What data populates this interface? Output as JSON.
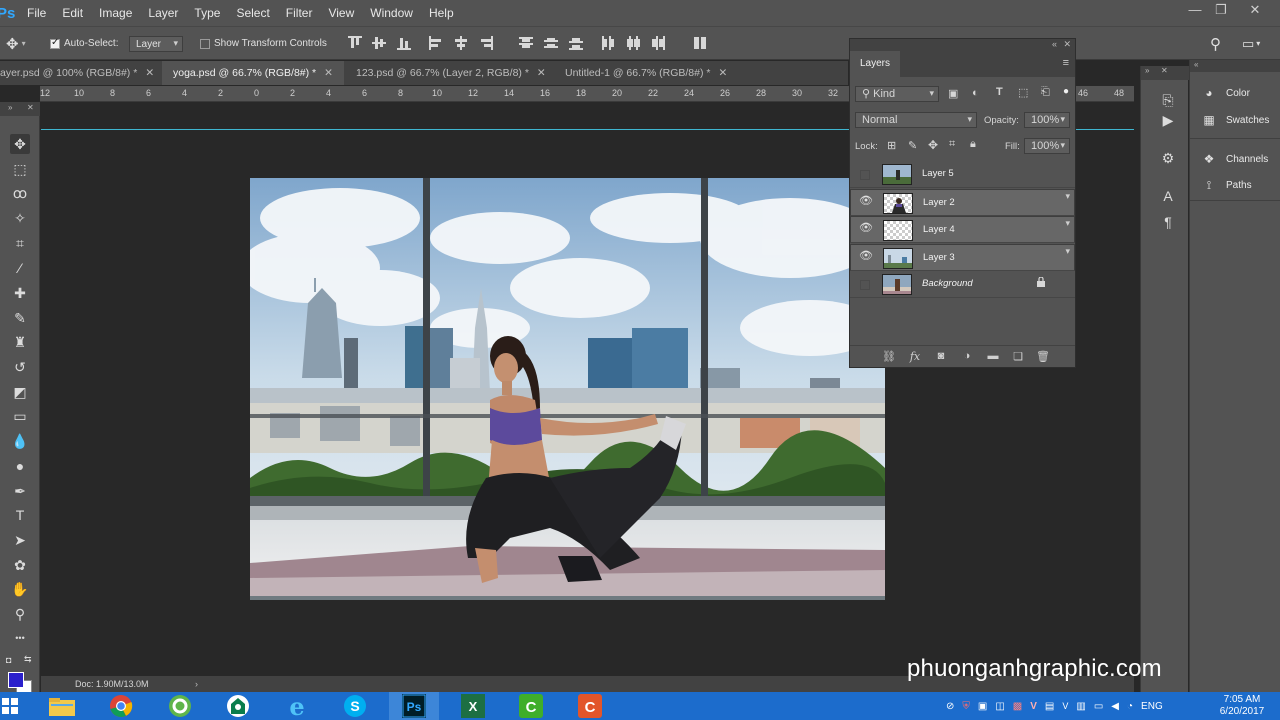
{
  "app": {
    "logo": "Ps"
  },
  "menu": [
    "File",
    "Edit",
    "Image",
    "Layer",
    "Type",
    "Select",
    "Filter",
    "View",
    "Window",
    "Help"
  ],
  "window_controls": {
    "minimize": "—",
    "restore": "❐",
    "close": "✕"
  },
  "options_bar": {
    "auto_select_label": "Auto-Select:",
    "auto_select_checked": true,
    "auto_select_target": "Layer",
    "transform_controls_label": "Show Transform Controls",
    "transform_controls_checked": false
  },
  "tabs": [
    {
      "label": "ayer.psd @ 100% (RGB/8#) *",
      "active": false
    },
    {
      "label": "yoga.psd @ 66.7% (RGB/8#) *",
      "active": true
    },
    {
      "label": "123.psd @ 66.7% (Layer 2, RGB/8) *",
      "active": false
    },
    {
      "label": "Untitled-1 @ 66.7% (RGB/8#) *",
      "active": false
    }
  ],
  "ruler_labels": [
    "12",
    "10",
    "8",
    "6",
    "4",
    "2",
    "0",
    "2",
    "4",
    "6",
    "8",
    "10",
    "12",
    "14",
    "16",
    "18",
    "20",
    "22",
    "24",
    "26",
    "28",
    "30",
    "32",
    "46",
    "48"
  ],
  "toolbar_tools": [
    {
      "name": "move-tool-icon",
      "glyph": "✥"
    },
    {
      "name": "marquee-tool-icon",
      "glyph": "⬚"
    },
    {
      "name": "lasso-tool-icon",
      "glyph": "ꝏ"
    },
    {
      "name": "magic-wand-tool-icon",
      "glyph": "✧"
    },
    {
      "name": "crop-tool-icon",
      "glyph": "⌗"
    },
    {
      "name": "eyedropper-tool-icon",
      "glyph": "⁄"
    },
    {
      "name": "healing-brush-tool-icon",
      "glyph": "✚"
    },
    {
      "name": "brush-tool-icon",
      "glyph": "✎"
    },
    {
      "name": "clone-stamp-tool-icon",
      "glyph": "♜"
    },
    {
      "name": "history-brush-tool-icon",
      "glyph": "↺"
    },
    {
      "name": "eraser-tool-icon",
      "glyph": "◩"
    },
    {
      "name": "gradient-tool-icon",
      "glyph": "▭"
    },
    {
      "name": "blur-tool-icon",
      "glyph": "💧"
    },
    {
      "name": "dodge-tool-icon",
      "glyph": "●"
    },
    {
      "name": "pen-tool-icon",
      "glyph": "✒"
    },
    {
      "name": "type-tool-icon",
      "glyph": "T"
    },
    {
      "name": "path-selection-tool-icon",
      "glyph": "➤"
    },
    {
      "name": "custom-shape-tool-icon",
      "glyph": "✿"
    },
    {
      "name": "hand-tool-icon",
      "glyph": "✋"
    },
    {
      "name": "zoom-tool-icon",
      "glyph": "⚲"
    },
    {
      "name": "more-tools-icon",
      "glyph": "•••"
    }
  ],
  "colors": {
    "foreground": "#2b20cc",
    "background": "#ffffff",
    "guide": "#3fb6d0"
  },
  "status": {
    "doc_size": "Doc: 1.90M/13.0M"
  },
  "layers_panel": {
    "title": "Layers",
    "filter_label": "Kind",
    "blend_mode": "Normal",
    "opacity_label": "Opacity:",
    "opacity_value": "100%",
    "lock_label": "Lock:",
    "fill_label": "Fill:",
    "fill_value": "100%",
    "layers": [
      {
        "name": "Layer 5",
        "visible": false,
        "selected": false,
        "thumb": "photo",
        "locked": false
      },
      {
        "name": "Layer 2",
        "visible": true,
        "selected": true,
        "thumb": "checker-person",
        "locked": false
      },
      {
        "name": "Layer 4",
        "visible": true,
        "selected": true,
        "thumb": "checker",
        "locked": false
      },
      {
        "name": "Layer 3",
        "visible": true,
        "selected": true,
        "thumb": "city",
        "locked": false
      },
      {
        "name": "Background",
        "visible": false,
        "selected": false,
        "thumb": "room",
        "locked": true
      }
    ]
  },
  "dock_panels": [
    {
      "label": "Color",
      "icon": "palette-icon"
    },
    {
      "label": "Swatches",
      "icon": "swatches-icon"
    },
    {
      "label": "Channels",
      "icon": "channels-icon"
    },
    {
      "label": "Paths",
      "icon": "paths-icon"
    }
  ],
  "watermark": "phuonganhgraphic.com",
  "taskbar": {
    "apps": [
      "file-explorer-icon",
      "chrome-icon",
      "coccoc-icon",
      "app-green-icon",
      "internet-explorer-icon",
      "skype-icon",
      "photoshop-icon",
      "excel-icon",
      "camtasia-icon",
      "camtasia-recorder-icon"
    ],
    "language": "ENG",
    "time": "7:05 AM",
    "date": "6/20/2017"
  }
}
